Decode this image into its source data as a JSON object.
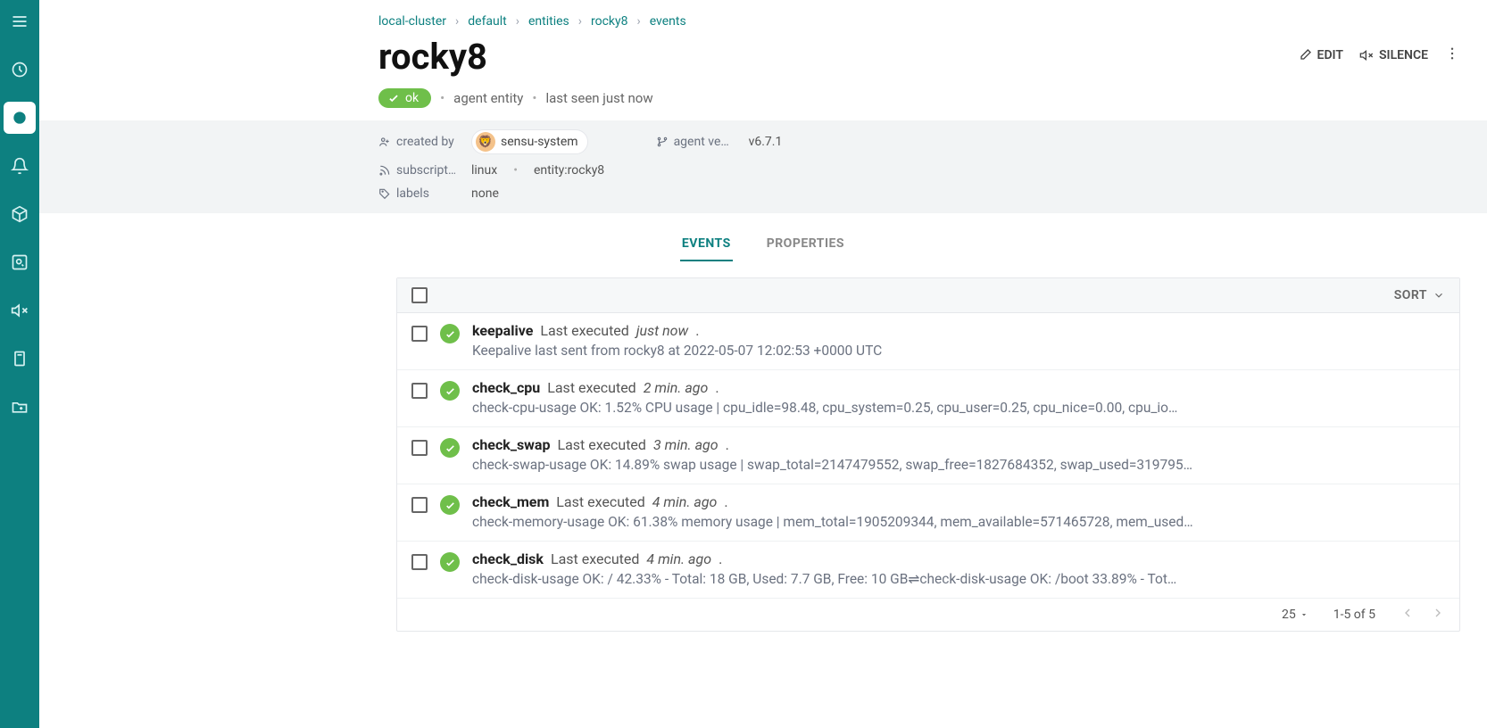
{
  "breadcrumbs": [
    "local-cluster",
    "default",
    "entities",
    "rocky8",
    "events"
  ],
  "title": "rocky8",
  "actions": {
    "edit": "EDIT",
    "silence": "SILENCE"
  },
  "status": {
    "pill": "ok",
    "type": "agent entity",
    "last_seen": "last seen just now"
  },
  "meta": {
    "created_by_label": "created by",
    "created_by_value": "sensu-system",
    "agent_version_label": "agent ve…",
    "agent_version_value": "v6.7.1",
    "subscriptions_label": "subscript…",
    "subscriptions_v1": "linux",
    "subscriptions_v2": "entity:rocky8",
    "labels_label": "labels",
    "labels_value": "none"
  },
  "tabs": {
    "events": "EVENTS",
    "properties": "PROPERTIES"
  },
  "sort_label": "SORT",
  "events": [
    {
      "name": "keepalive",
      "exec_prefix": "Last executed",
      "exec_time": "just now",
      "desc": "Keepalive last sent from rocky8 at 2022-05-07 12:02:53 +0000 UTC"
    },
    {
      "name": "check_cpu",
      "exec_prefix": "Last executed",
      "exec_time": "2 min. ago",
      "desc": "check-cpu-usage OK: 1.52% CPU usage | cpu_idle=98.48, cpu_system=0.25, cpu_user=0.25, cpu_nice=0.00, cpu_io…"
    },
    {
      "name": "check_swap",
      "exec_prefix": "Last executed",
      "exec_time": "3 min. ago",
      "desc": "check-swap-usage OK: 14.89% swap usage | swap_total=2147479552, swap_free=1827684352, swap_used=319795…"
    },
    {
      "name": "check_mem",
      "exec_prefix": "Last executed",
      "exec_time": "4 min. ago",
      "desc": "check-memory-usage OK: 61.38% memory usage | mem_total=1905209344, mem_available=571465728, mem_used…"
    },
    {
      "name": "check_disk",
      "exec_prefix": "Last executed",
      "exec_time": "4 min. ago",
      "desc": "check-disk-usage OK: / 42.33% - Total: 18 GB, Used: 7.7 GB, Free: 10 GB⇌check-disk-usage OK: /boot 33.89% - Tot…"
    }
  ],
  "pagination": {
    "per_page": "25",
    "range": "1-5 of 5"
  }
}
